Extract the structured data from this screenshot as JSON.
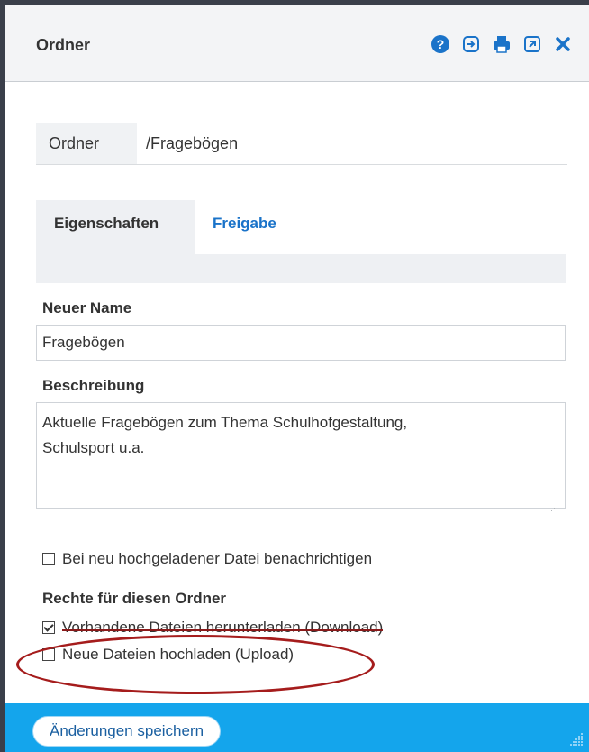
{
  "header": {
    "title": "Ordner",
    "icons": [
      "help-icon",
      "move-icon",
      "print-icon",
      "external-link-icon",
      "close-icon"
    ],
    "accent": "#1a73c9"
  },
  "folder": {
    "label": "Ordner",
    "value": "/Fragebögen"
  },
  "tabs": [
    {
      "label": "Eigenschaften",
      "active": true
    },
    {
      "label": "Freigabe",
      "active": false
    }
  ],
  "form": {
    "name_label": "Neuer Name",
    "name_value": "Fragebögen",
    "desc_label": "Beschreibung",
    "desc_value": "Aktuelle Fragebögen zum Thema Schulhofgestaltung,\nSchulsport u.a.",
    "notify_label": "Bei neu hochgeladener Datei benachrichtigen",
    "notify_checked": false,
    "rights_label": "Rechte für diesen Ordner",
    "download_label": "Vorhandene Dateien herunterladen (Download)",
    "download_checked": true,
    "upload_label": "Neue Dateien hochladen (Upload)",
    "upload_checked": false
  },
  "footer": {
    "save_label": "Änderungen speichern",
    "bar_color": "#14a5ec"
  },
  "annotation_color": "#a51c1c"
}
